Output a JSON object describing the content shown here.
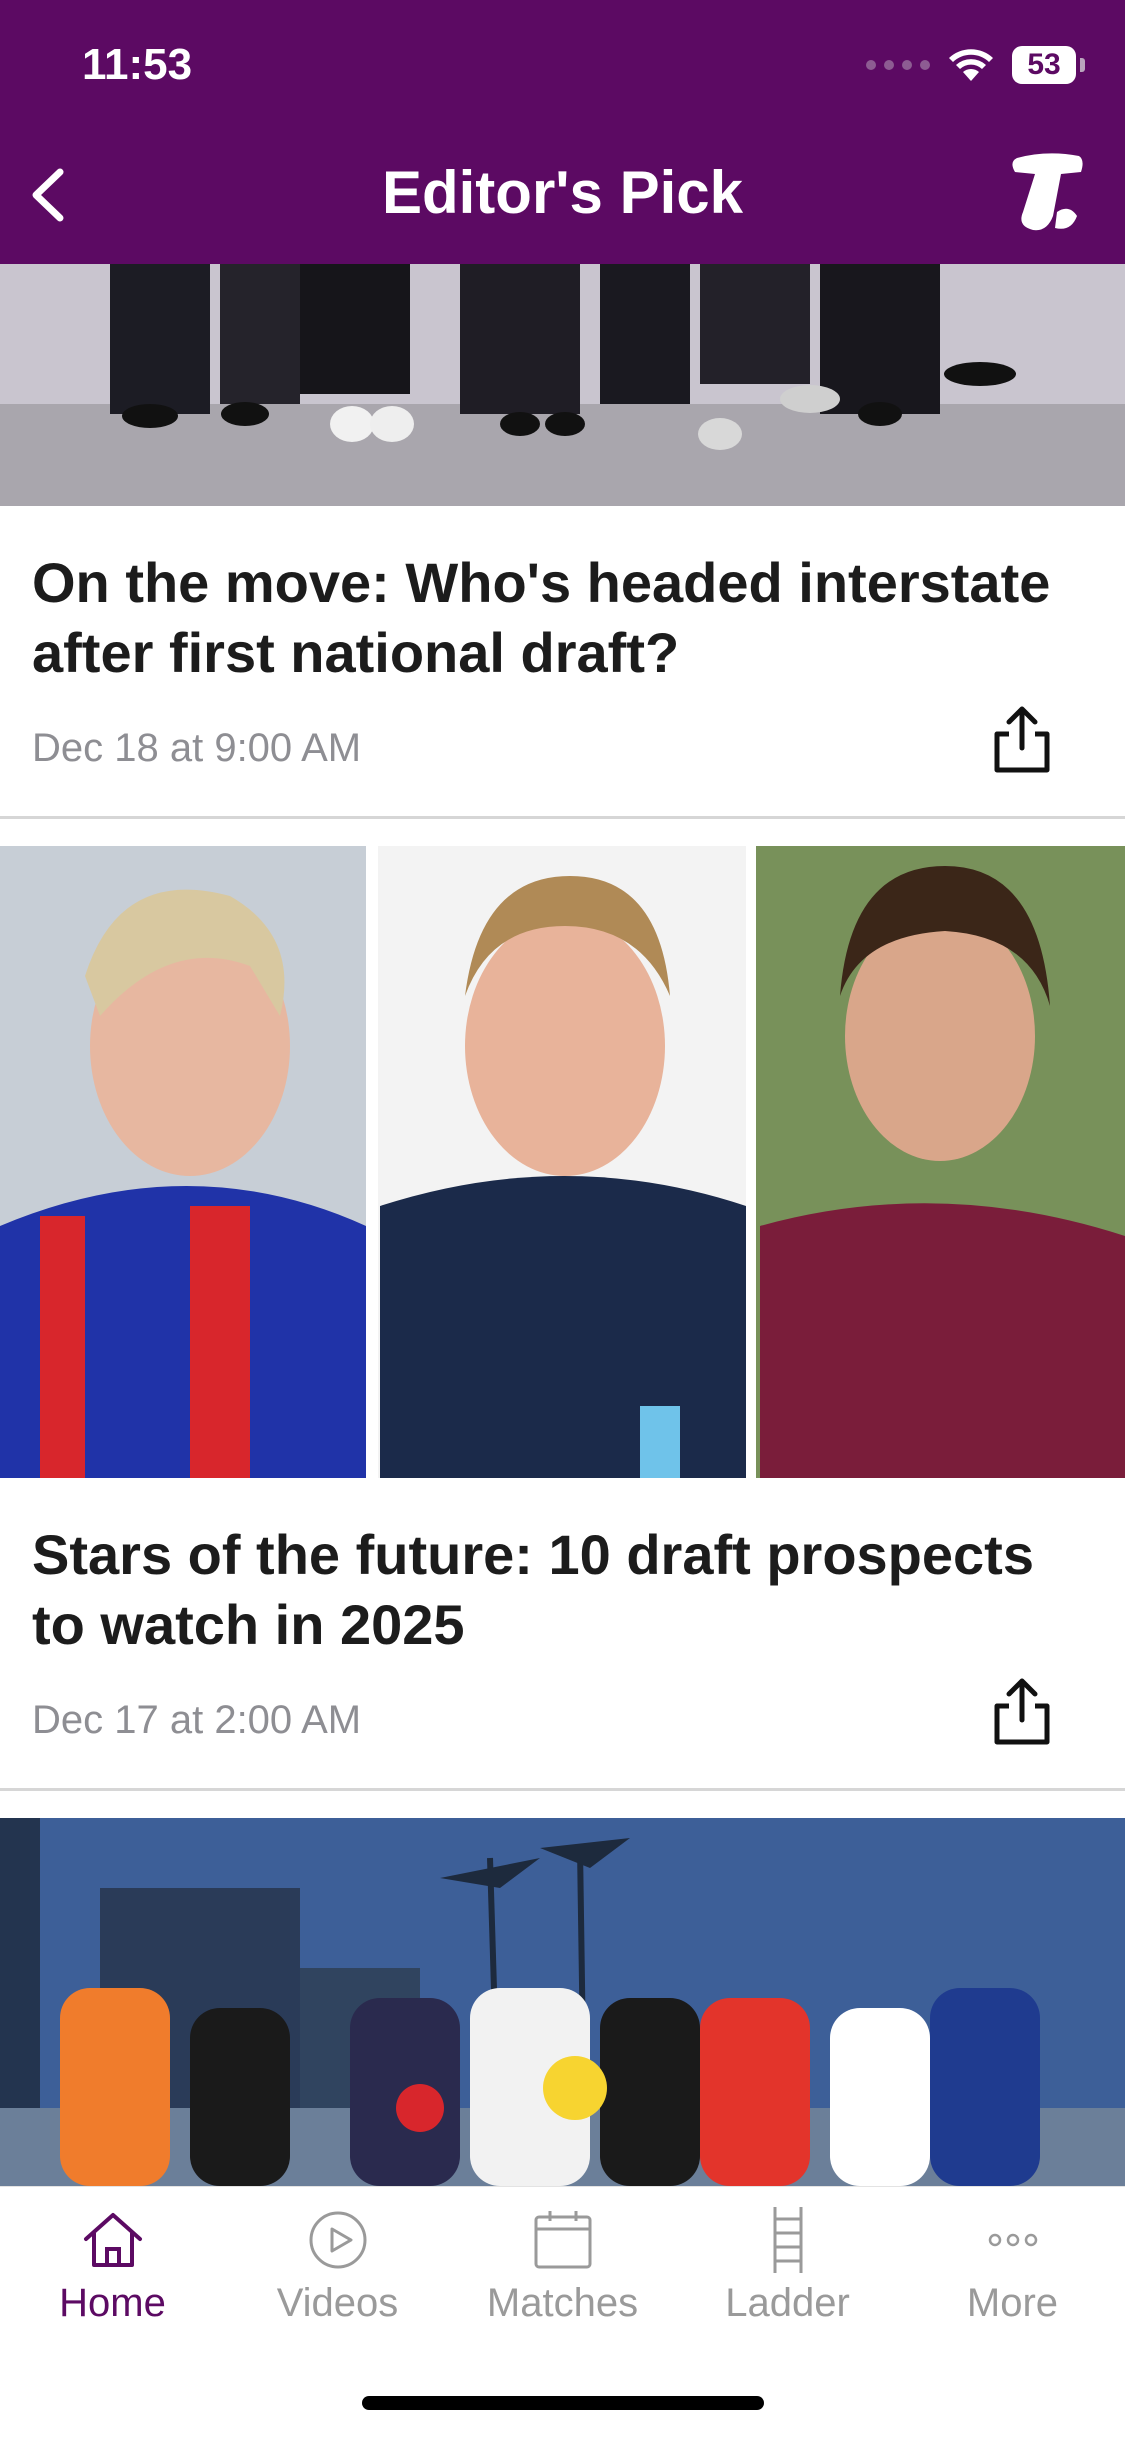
{
  "status_bar": {
    "time": "11:53",
    "battery": "53"
  },
  "header": {
    "title": "Editor's Pick",
    "back_icon": "chevron-left-icon",
    "logo_icon": "telstra-logo"
  },
  "articles": [
    {
      "title": "On the move: Who's headed interstate after first national draft?",
      "date": "Dec 18 at 9:00 AM",
      "share_icon": "share-icon"
    },
    {
      "title": "Stars of the future: 10 draft prospects to watch in 2025",
      "date": "Dec 17 at 2:00 AM",
      "share_icon": "share-icon"
    }
  ],
  "tabs": [
    {
      "label": "Home",
      "icon": "home-icon",
      "active": true
    },
    {
      "label": "Videos",
      "icon": "play-icon",
      "active": false
    },
    {
      "label": "Matches",
      "icon": "calendar-icon",
      "active": false
    },
    {
      "label": "Ladder",
      "icon": "ladder-icon",
      "active": false
    },
    {
      "label": "More",
      "icon": "more-icon",
      "active": false
    }
  ],
  "colors": {
    "brand": "#5c0a63",
    "inactive": "#9a9a9a"
  }
}
